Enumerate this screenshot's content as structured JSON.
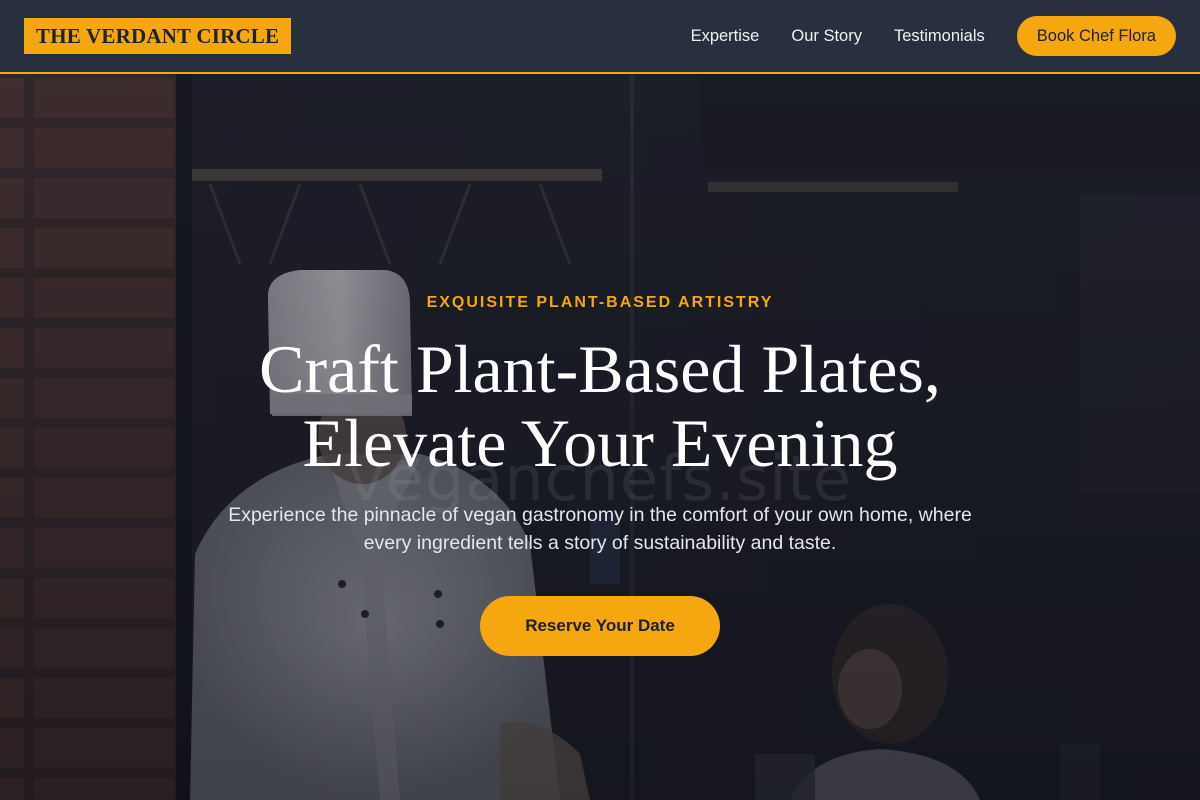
{
  "brand": {
    "name": "THE VERDANT CIRCLE"
  },
  "nav": {
    "links": [
      {
        "label": "Expertise"
      },
      {
        "label": "Our Story"
      },
      {
        "label": "Testimonials"
      }
    ],
    "cta_label": "Book Chef Flora"
  },
  "hero": {
    "eyebrow": "EXQUISITE PLANT-BASED ARTISTRY",
    "headline_line1": "Craft Plant-Based Plates,",
    "headline_line2": "Elevate Your Evening",
    "subtext_line1": "Experience the pinnacle of vegan gastronomy in the comfort of your own home, where",
    "subtext_line2": "every ingredient tells a story of sustainability and taste.",
    "cta_label": "Reserve Your Date",
    "watermark": "veganchefs.site",
    "background_icon": "chef-kitchen-photo"
  },
  "colors": {
    "accent": "#f5a70f",
    "nav_bg": "#28303f",
    "hero_text": "#ffffff"
  }
}
